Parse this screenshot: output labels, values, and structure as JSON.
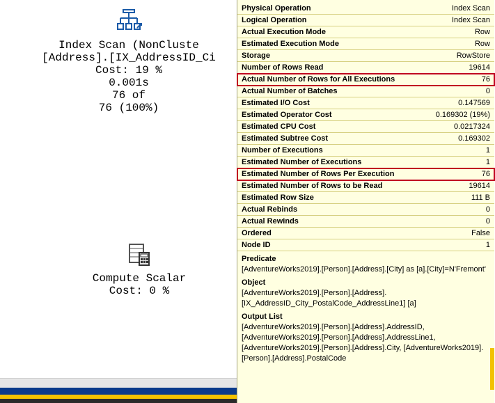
{
  "plan": {
    "node1": {
      "title": "Index Scan (NonCluste",
      "subtitle": "[Address].[IX_AddressID_Ci",
      "cost": "Cost: 19 %",
      "time": "0.001s",
      "rows1": "76 of",
      "rows2": "76 (100%)"
    },
    "node2": {
      "title": "Compute Scalar",
      "cost": "Cost: 0 %"
    }
  },
  "props": [
    {
      "label": "Physical Operation",
      "value": "Index Scan",
      "hl": false
    },
    {
      "label": "Logical Operation",
      "value": "Index Scan",
      "hl": false
    },
    {
      "label": "Actual Execution Mode",
      "value": "Row",
      "hl": false
    },
    {
      "label": "Estimated Execution Mode",
      "value": "Row",
      "hl": false
    },
    {
      "label": "Storage",
      "value": "RowStore",
      "hl": false
    },
    {
      "label": "Number of Rows Read",
      "value": "19614",
      "hl": false
    },
    {
      "label": "Actual Number of Rows for All Executions",
      "value": "76",
      "hl": true
    },
    {
      "label": "Actual Number of Batches",
      "value": "0",
      "hl": false
    },
    {
      "label": "Estimated I/O Cost",
      "value": "0.147569",
      "hl": false
    },
    {
      "label": "Estimated Operator Cost",
      "value": "0.169302 (19%)",
      "hl": false
    },
    {
      "label": "Estimated CPU Cost",
      "value": "0.0217324",
      "hl": false
    },
    {
      "label": "Estimated Subtree Cost",
      "value": "0.169302",
      "hl": false
    },
    {
      "label": "Number of Executions",
      "value": "1",
      "hl": false
    },
    {
      "label": "Estimated Number of Executions",
      "value": "1",
      "hl": false
    },
    {
      "label": "Estimated Number of Rows Per Execution",
      "value": "76",
      "hl": true
    },
    {
      "label": "Estimated Number of Rows to be Read",
      "value": "19614",
      "hl": false
    },
    {
      "label": "Estimated Row Size",
      "value": "111 B",
      "hl": false
    },
    {
      "label": "Actual Rebinds",
      "value": "0",
      "hl": false
    },
    {
      "label": "Actual Rewinds",
      "value": "0",
      "hl": false
    },
    {
      "label": "Ordered",
      "value": "False",
      "hl": false
    },
    {
      "label": "Node ID",
      "value": "1",
      "hl": false
    }
  ],
  "sections": {
    "predicate": {
      "hdr": "Predicate",
      "txt": "[AdventureWorks2019].[Person].[Address].[City] as [a].[City]=N'Fremont'"
    },
    "object": {
      "hdr": "Object",
      "txt": "[AdventureWorks2019].[Person].[Address].[IX_AddressID_City_PostalCode_AddressLine1] [a]"
    },
    "output": {
      "hdr": "Output List",
      "txt": "[AdventureWorks2019].[Person].[Address].AddressID, [AdventureWorks2019].[Person].[Address].AddressLine1, [AdventureWorks2019].[Person].[Address].City, [AdventureWorks2019].[Person].[Address].PostalCode"
    }
  }
}
